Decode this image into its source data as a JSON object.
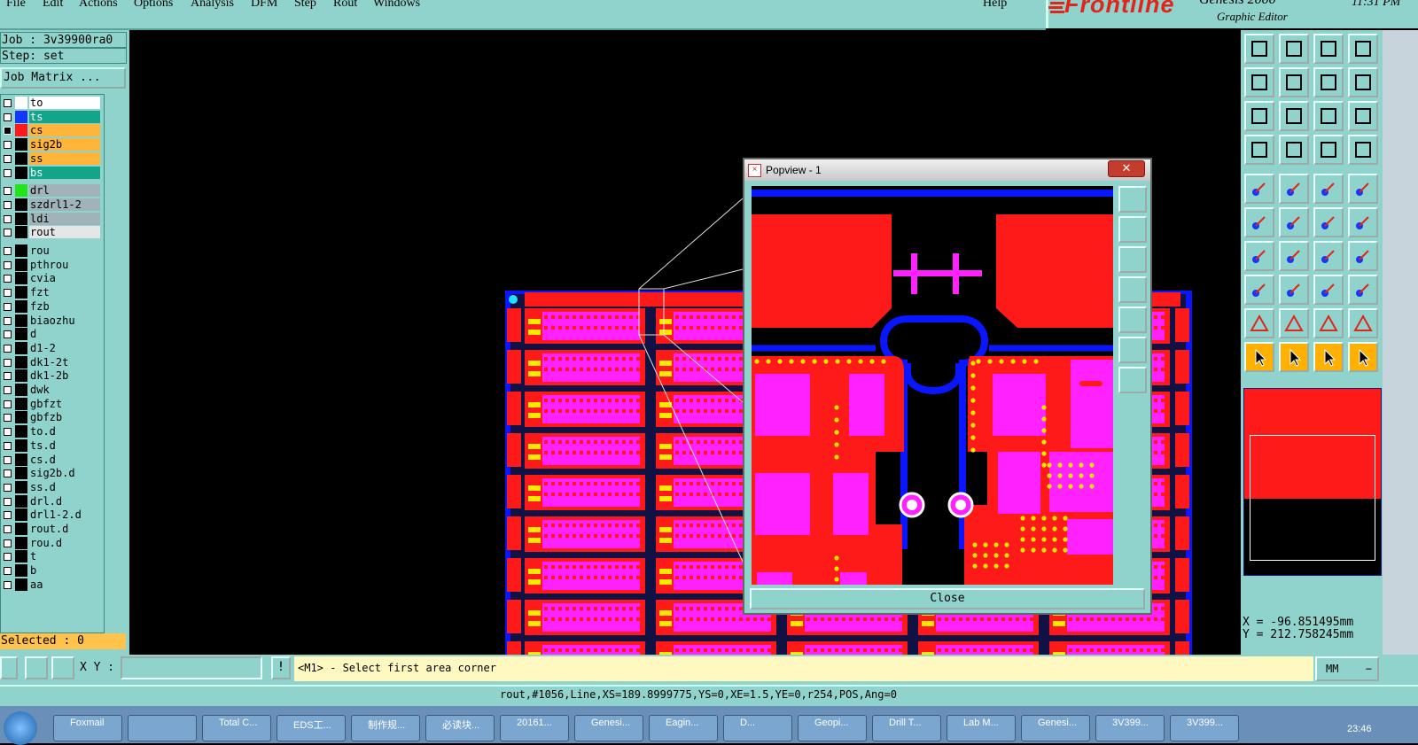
{
  "menu": {
    "items": [
      "File",
      "Edit",
      "Actions",
      "Options",
      "Analysis",
      "DFM",
      "Step",
      "Rout",
      "Windows"
    ],
    "help": "Help"
  },
  "brand": {
    "logo": "Frontline",
    "product": "Genesis 2000",
    "subtitle": "Graphic Editor",
    "time": "11:31 PM"
  },
  "job": {
    "job_label": "Job : 3v39900ra0",
    "step_label": "Step: set",
    "matrix_button": "Job Matrix ..."
  },
  "layers": [
    {
      "name": "to",
      "color": "#ffffff",
      "bg": "#ffffff",
      "fg": "#000000",
      "active": false
    },
    {
      "name": "ts",
      "color": "#1436ff",
      "bg": "#13a589",
      "fg": "#ffffff",
      "active": false
    },
    {
      "name": "cs",
      "color": "#ff1a1a",
      "bg": "#ffb43a",
      "fg": "#000000",
      "active": true
    },
    {
      "name": "sig2b",
      "color": "",
      "bg": "#ffb43a",
      "fg": "#000000",
      "active": false
    },
    {
      "name": "ss",
      "color": "",
      "bg": "#ffb43a",
      "fg": "#000000",
      "active": false
    },
    {
      "name": "bs",
      "color": "",
      "bg": "#13a589",
      "fg": "#ffffff",
      "active": false
    },
    {
      "name": "drl",
      "color": "#22e61a",
      "bg": "#9fb3b8",
      "fg": "#000000",
      "active": false
    },
    {
      "name": "szdrl1-2",
      "color": "",
      "bg": "#9fb3b8",
      "fg": "#000000",
      "active": false
    },
    {
      "name": "ldi",
      "color": "",
      "bg": "#9fb3b8",
      "fg": "#000000",
      "active": false
    },
    {
      "name": "rout",
      "color": "",
      "bg": "#e6e6e6",
      "fg": "#000000",
      "active": false
    },
    {
      "name": "rou",
      "color": "",
      "bg": "#8fd3cc",
      "fg": "#000000",
      "active": false
    },
    {
      "name": "pthrou",
      "color": "",
      "bg": "#8fd3cc",
      "fg": "#000000",
      "active": false
    },
    {
      "name": "cvia",
      "color": "",
      "bg": "#8fd3cc",
      "fg": "#000000",
      "active": false
    },
    {
      "name": "fzt",
      "color": "",
      "bg": "#8fd3cc",
      "fg": "#000000",
      "active": false
    },
    {
      "name": "fzb",
      "color": "",
      "bg": "#8fd3cc",
      "fg": "#000000",
      "active": false
    },
    {
      "name": "biaozhu",
      "color": "",
      "bg": "#8fd3cc",
      "fg": "#000000",
      "active": false
    },
    {
      "name": "d",
      "color": "",
      "bg": "#8fd3cc",
      "fg": "#000000",
      "active": false
    },
    {
      "name": "d1-2",
      "color": "",
      "bg": "#8fd3cc",
      "fg": "#000000",
      "active": false
    },
    {
      "name": "dk1-2t",
      "color": "",
      "bg": "#8fd3cc",
      "fg": "#000000",
      "active": false
    },
    {
      "name": "dk1-2b",
      "color": "",
      "bg": "#8fd3cc",
      "fg": "#000000",
      "active": false
    },
    {
      "name": "dwk",
      "color": "",
      "bg": "#8fd3cc",
      "fg": "#000000",
      "active": false
    },
    {
      "name": "gbfzt",
      "color": "",
      "bg": "#8fd3cc",
      "fg": "#000000",
      "active": false
    },
    {
      "name": "gbfzb",
      "color": "",
      "bg": "#8fd3cc",
      "fg": "#000000",
      "active": false
    },
    {
      "name": "to.d",
      "color": "",
      "bg": "#8fd3cc",
      "fg": "#000000",
      "active": false
    },
    {
      "name": "ts.d",
      "color": "",
      "bg": "#8fd3cc",
      "fg": "#000000",
      "active": false
    },
    {
      "name": "cs.d",
      "color": "",
      "bg": "#8fd3cc",
      "fg": "#000000",
      "active": false
    },
    {
      "name": "sig2b.d",
      "color": "",
      "bg": "#8fd3cc",
      "fg": "#000000",
      "active": false
    },
    {
      "name": "ss.d",
      "color": "",
      "bg": "#8fd3cc",
      "fg": "#000000",
      "active": false
    },
    {
      "name": "drl.d",
      "color": "",
      "bg": "#8fd3cc",
      "fg": "#000000",
      "active": false
    },
    {
      "name": "drl1-2.d",
      "color": "",
      "bg": "#8fd3cc",
      "fg": "#000000",
      "active": false
    },
    {
      "name": "rout.d",
      "color": "",
      "bg": "#8fd3cc",
      "fg": "#000000",
      "active": false
    },
    {
      "name": "rou.d",
      "color": "",
      "bg": "#8fd3cc",
      "fg": "#000000",
      "active": false
    },
    {
      "name": "t",
      "color": "",
      "bg": "#8fd3cc",
      "fg": "#000000",
      "active": false
    },
    {
      "name": "b",
      "color": "",
      "bg": "#8fd3cc",
      "fg": "#000000",
      "active": false
    },
    {
      "name": "aa",
      "color": "",
      "bg": "#8fd3cc",
      "fg": "#000000",
      "active": false
    }
  ],
  "selected": "Selected : 0",
  "coords": {
    "x": "X = -96.851495mm",
    "y": "Y = 212.758245mm"
  },
  "command": {
    "xy_label": "X Y :",
    "xy_value": "",
    "prompt": "<M1> - Select first area corner",
    "units": "MM"
  },
  "status": "rout,#1056,Line,XS=189.8999775,YS=0,XE=1.5,YE=0,r254,POS,Ang=0",
  "popview": {
    "title": "Popview - 1",
    "close_label": "Close",
    "close_x": "✕"
  },
  "toolbar_icons": [
    "open-icon",
    "save-icon",
    "home-icon",
    "grid-icon",
    "back-icon",
    "forward-icon",
    "undo-icon",
    "redo-icon",
    "fit-icon",
    "zoom-icon",
    "scale-icon",
    "help-icon",
    "settings-icon",
    "probe-icon",
    "net-icon",
    "net2-icon",
    "snap-icon",
    "measure-icon",
    "ruler-icon",
    "pad-icon",
    "connect-icon",
    "cross-icon",
    "line-icon",
    "line2-icon",
    "angle-icon",
    "draw-icon",
    "arc-icon",
    "split-icon",
    "move-icon",
    "minus-icon",
    "resize-icon",
    "copy-icon",
    "triangle-icon",
    "poly-icon",
    "poly2-icon",
    "poly3-icon",
    "select-icon",
    "select2-icon",
    "select3-icon",
    "select4-icon"
  ],
  "taskbar_items": [
    "Foxmail",
    "",
    "Total C...",
    "EDS工...",
    "制作规...",
    "必读块...",
    "20161...",
    "Genesi...",
    "Eagin...",
    "D...",
    "Geopi...",
    "Drill T...",
    "Lab M...",
    "Genesi...",
    "3V399...",
    "3V399..."
  ],
  "taskbar_time": "23:46",
  "colors": {
    "panel": "#8fd3cc",
    "copper": "#ff1a1a",
    "pad": "#ff22ff",
    "trace": "#0a16ff",
    "via": "#ffe800"
  }
}
